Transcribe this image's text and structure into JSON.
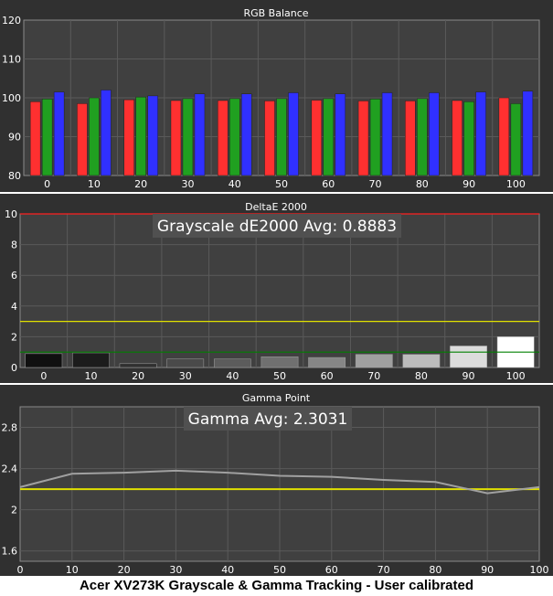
{
  "colors": {
    "panel_bg": "#303030",
    "plot_bg": "#404040",
    "grid": "#5a5a5a",
    "text": "#ffffff",
    "red": "#ff3030",
    "green": "#20a020",
    "blue": "#3030ff",
    "yellow": "#e0e000",
    "dark_green": "#008000",
    "limit_red": "#ff2020",
    "gamma_line": "#a0a0a0",
    "avg_box": "#505050"
  },
  "caption": "Acer XV273K Grayscale & Gamma Tracking - User calibrated",
  "chart_data": [
    {
      "type": "bar",
      "title": "RGB Balance",
      "categories": [
        "0",
        "10",
        "20",
        "30",
        "40",
        "50",
        "60",
        "70",
        "80",
        "90",
        "100"
      ],
      "ylim": [
        80,
        120
      ],
      "yticks": [
        80,
        90,
        100,
        110,
        120
      ],
      "grid": true,
      "series": [
        {
          "color_key": "red",
          "values": [
            99,
            98.5,
            99.5,
            99.3,
            99.3,
            99.2,
            99.4,
            99.2,
            99.2,
            99.3,
            100
          ]
        },
        {
          "color_key": "green",
          "values": [
            99.7,
            100,
            100.2,
            99.8,
            99.8,
            99.8,
            99.8,
            99.7,
            99.8,
            99,
            98.5
          ]
        },
        {
          "color_key": "blue",
          "values": [
            101.5,
            102,
            100.5,
            101,
            101,
            101.3,
            101,
            101.3,
            101.3,
            101.5,
            101.7
          ]
        }
      ]
    },
    {
      "type": "bar",
      "title": "DeltaE 2000",
      "annotation": "Grayscale dE2000 Avg: 0.8883",
      "categories": [
        "0",
        "10",
        "20",
        "30",
        "40",
        "50",
        "60",
        "70",
        "80",
        "90",
        "100"
      ],
      "values": [
        0.9,
        0.95,
        0.25,
        0.55,
        0.55,
        0.7,
        0.65,
        0.85,
        0.85,
        1.4,
        2.0
      ],
      "bar_colors": [
        "#101010",
        "#1c1c1c",
        "#303030",
        "#4a4a4a",
        "#5c5c5c",
        "#707070",
        "#868686",
        "#a0a0a0",
        "#bcbcbc",
        "#dcdcdc",
        "#ffffff"
      ],
      "ylim": [
        0,
        10
      ],
      "yticks": [
        0,
        2,
        4,
        6,
        8,
        10
      ],
      "reference_lines": [
        {
          "y": 3,
          "color_key": "yellow"
        },
        {
          "y": 1,
          "color_key": "dark_green"
        },
        {
          "y": 10,
          "color_key": "limit_red"
        }
      ],
      "grid": true
    },
    {
      "type": "line",
      "title": "Gamma Point",
      "annotation": "Gamma Avg: 2.3031",
      "x": [
        0,
        10,
        20,
        30,
        40,
        50,
        60,
        70,
        80,
        90,
        100
      ],
      "y": [
        2.22,
        2.35,
        2.36,
        2.38,
        2.36,
        2.33,
        2.32,
        2.29,
        2.27,
        2.16,
        2.22
      ],
      "xlim": [
        0,
        100
      ],
      "ylim": [
        1.5,
        3.0
      ],
      "yticks": [
        1.6,
        2.0,
        2.4,
        2.8
      ],
      "xticks": [
        0,
        10,
        20,
        30,
        40,
        50,
        60,
        70,
        80,
        90,
        100
      ],
      "reference_lines": [
        {
          "y": 2.2,
          "color_key": "yellow"
        }
      ],
      "grid": true
    }
  ]
}
